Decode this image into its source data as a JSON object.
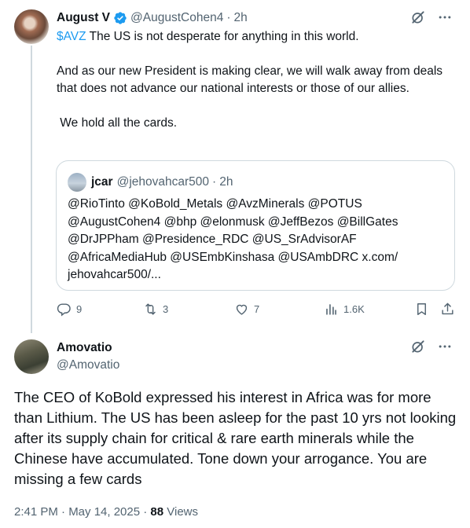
{
  "tweet1": {
    "display_name": "August V",
    "handle": "@AugustCohen4",
    "separator": "·",
    "time": "2h",
    "cashtag": "$AVZ",
    "line1_rest": " The US is not desperate for anything in this world.",
    "line2": "And as our new President is making clear, we will walk away from deals that does not advance our national interests or those of our allies.",
    "line3": " We hold all the cards.",
    "quote": {
      "display_name": "jcar",
      "handle": "@jehovahcar500",
      "separator": "·",
      "time": "2h",
      "text": "@RioTinto @KoBold_Metals @AvzMinerals @POTUS @AugustCohen4  @bhp @elonmusk @JeffBezos @BillGates @DrJPPham @Presidence_RDC @US_SrAdvisorAF @AfricaMediaHub @USEmbKinshasa @USAmbDRC x.com/ jehovahcar500/..."
    },
    "actions": {
      "replies": "9",
      "reposts": "3",
      "likes": "7",
      "views": "1.6K"
    }
  },
  "tweet2": {
    "display_name": "Amovatio",
    "handle": "@Amovatio",
    "text": "The CEO of KoBold expressed his interest in Africa was for more than Lithium. The US has been asleep for the past 10 yrs not looking after its supply chain for critical & rare earth minerals while the Chinese have accumulated. Tone down your arrogance. You are missing a few cards",
    "timestamp": "2:41 PM · May 14, 2025 · ",
    "views_count": "88",
    "views_label": " Views"
  },
  "colors": {
    "accent": "#1d9bf0",
    "secondary_text": "#536471",
    "border": "#cfd9de"
  },
  "icons": [
    "verified-badge-icon",
    "grok-icon",
    "more-icon",
    "reply-icon",
    "repost-icon",
    "like-icon",
    "views-icon",
    "bookmark-icon",
    "share-icon"
  ]
}
